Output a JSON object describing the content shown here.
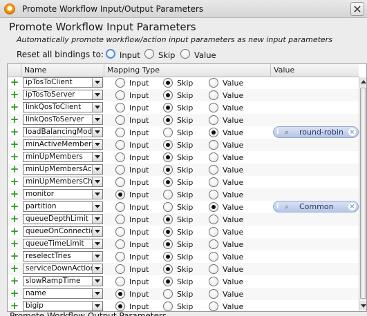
{
  "window": {
    "title": "Promote Workflow Input/Output Parameters",
    "close_glyph": "✕"
  },
  "heading": "Promote Workflow Input Parameters",
  "subtitle": "Automatically promote workflow/action input parameters as new input parameters",
  "reset": {
    "label": "Reset all bindings to:",
    "options": [
      "Input",
      "Skip",
      "Value"
    ]
  },
  "table": {
    "columns": [
      "Name",
      "Mapping Type",
      "Value"
    ],
    "option_labels": [
      "Input",
      "Skip",
      "Value"
    ],
    "rows": [
      {
        "name": "ipTosToClient",
        "mapping": "Skip",
        "value": ""
      },
      {
        "name": "ipTosToServer",
        "mapping": "Skip",
        "value": ""
      },
      {
        "name": "linkQosToClient",
        "mapping": "Skip",
        "value": ""
      },
      {
        "name": "linkQosToServer",
        "mapping": "Skip",
        "value": ""
      },
      {
        "name": "loadBalancingMode",
        "mapping": "Value",
        "value": "round-robin"
      },
      {
        "name": "minActiveMembers",
        "mapping": "Skip",
        "value": ""
      },
      {
        "name": "minUpMembers",
        "mapping": "Skip",
        "value": ""
      },
      {
        "name": "minUpMembersAction",
        "mapping": "Skip",
        "value": ""
      },
      {
        "name": "minUpMembersChecking",
        "mapping": "Skip",
        "value": ""
      },
      {
        "name": "monitor",
        "mapping": "Input",
        "value": ""
      },
      {
        "name": "partition",
        "mapping": "Value",
        "value": "Common"
      },
      {
        "name": "queueDepthLimit",
        "mapping": "Skip",
        "value": ""
      },
      {
        "name": "queueOnConnectionLimit",
        "mapping": "Skip",
        "value": ""
      },
      {
        "name": "queueTimeLimit",
        "mapping": "Skip",
        "value": ""
      },
      {
        "name": "reselectTries",
        "mapping": "Skip",
        "value": ""
      },
      {
        "name": "serviceDownAction",
        "mapping": "Skip",
        "value": ""
      },
      {
        "name": "slowRampTime",
        "mapping": "Skip",
        "value": ""
      },
      {
        "name": "name",
        "mapping": "Input",
        "value": ""
      },
      {
        "name": "bigip",
        "mapping": "Input",
        "value": ""
      }
    ]
  },
  "footer_cut_text": "Promote Workflow Output Parameters",
  "colors": {
    "add_icon": "#2f9a25",
    "value_pill": "#b6c6e6",
    "focus_ring": "#4a90d9"
  },
  "icons": {
    "add": "plus-icon",
    "search": "magnifier-icon",
    "clear": "clear-x-icon",
    "info": "info-icon",
    "dropdown": "chevron-down-icon"
  }
}
